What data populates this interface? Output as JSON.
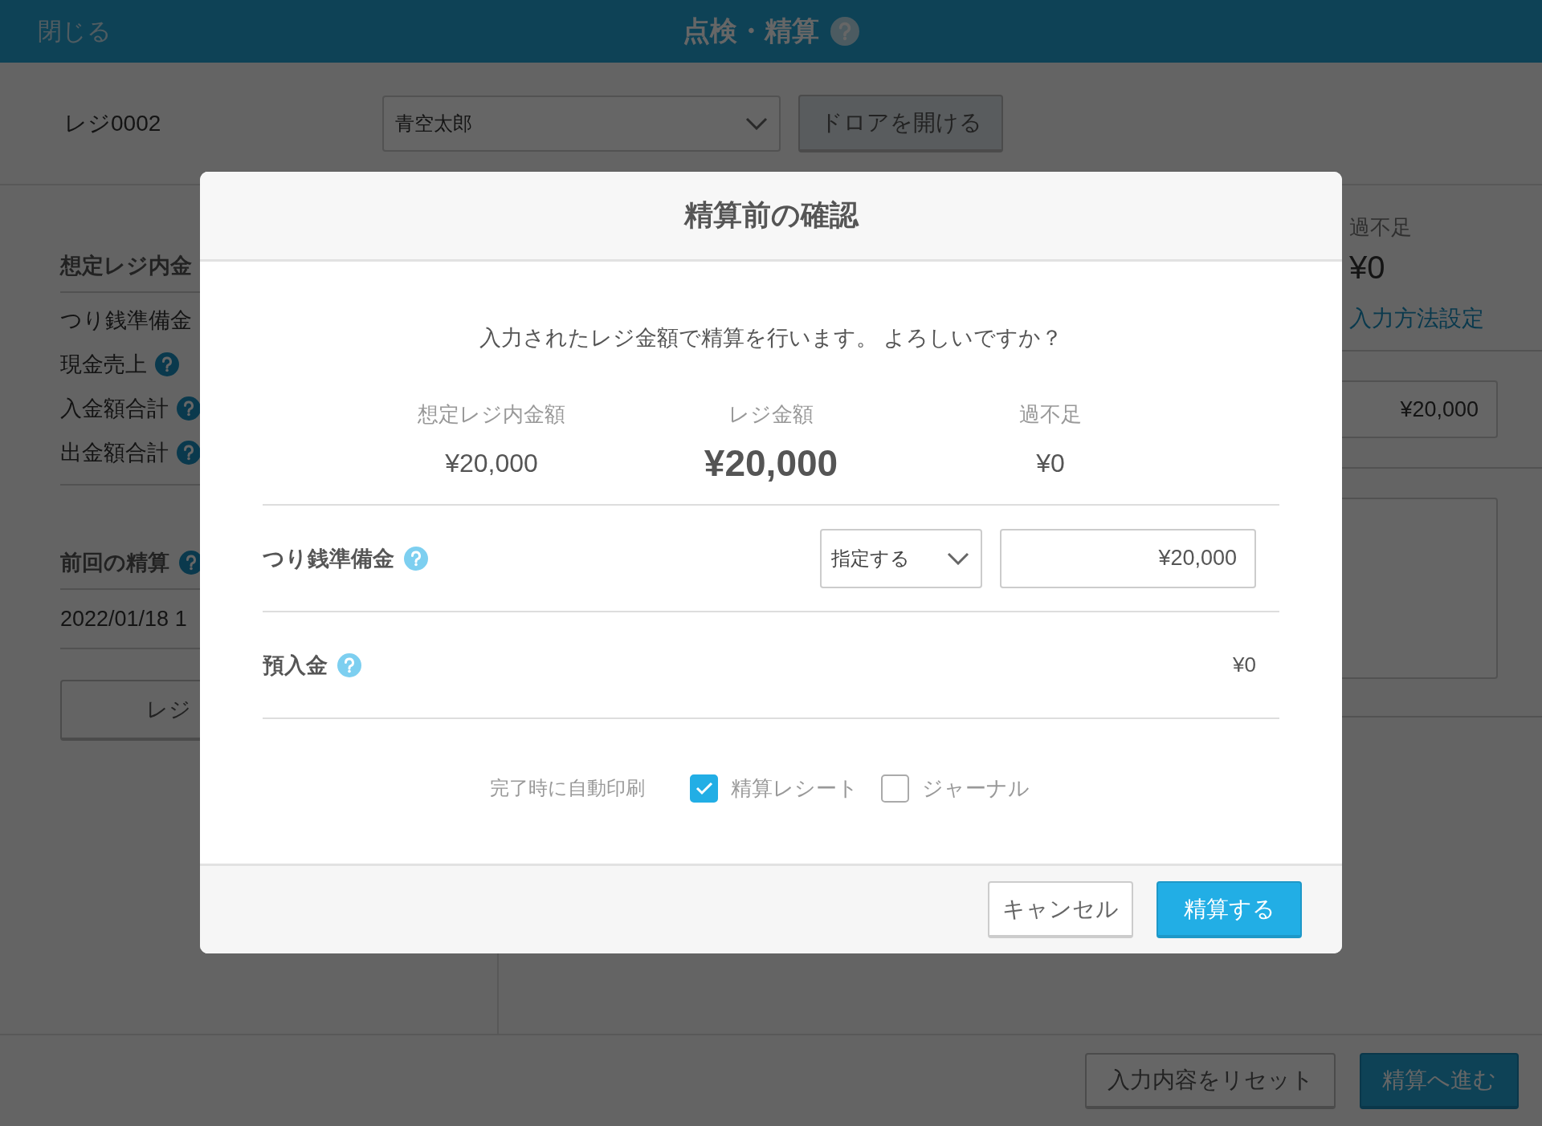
{
  "header": {
    "close": "閉じる",
    "title": "点検・精算"
  },
  "toolbar": {
    "register": "レジ0002",
    "staff_select": {
      "value": "青空太郎"
    },
    "drawer_button": "ドロアを開ける"
  },
  "left": {
    "expected_heading": "想定レジ内金",
    "items": [
      {
        "label": "つり銭準備金"
      },
      {
        "label": "現金売上",
        "help": true
      },
      {
        "label": "入金額合計",
        "help": true
      },
      {
        "label": "出金額合計",
        "help": true
      }
    ],
    "previous_heading": "前回の精算",
    "previous_date": "2022/01/18 1",
    "register_button": "レジ"
  },
  "right": {
    "over_short_label": "過不足",
    "over_short_value": "¥0",
    "input_method_link": "入力方法設定",
    "amount_field": {
      "value": "¥20,000"
    }
  },
  "footer": {
    "buttons": [
      {
        "label": "入力内容をリセット",
        "kind": "secondary"
      },
      {
        "label": "精算へ進む",
        "kind": "primary"
      }
    ]
  },
  "modal": {
    "title": "精算前の確認",
    "message": "入力されたレジ金額で精算を行います。 よろしいですか？",
    "summary": [
      {
        "label": "想定レジ内金額",
        "value": "¥20,000",
        "kind": "normal"
      },
      {
        "label": "レジ金額",
        "value": "¥20,000",
        "kind": "emphasis"
      },
      {
        "label": "過不足",
        "value": "¥0",
        "kind": "normal"
      }
    ],
    "rows": [
      {
        "label": "つり銭準備金",
        "kind": "select_input",
        "select": "指定する",
        "value": "¥20,000"
      },
      {
        "label": "預入金",
        "kind": "text",
        "value": "¥0"
      }
    ],
    "print": {
      "label": "完了時に自動印刷",
      "options": [
        {
          "label": "精算レシート",
          "checked": true
        },
        {
          "label": "ジャーナル",
          "checked": false
        }
      ]
    },
    "buttons": [
      {
        "label": "キャンセル",
        "kind": "secondary"
      },
      {
        "label": "精算する",
        "kind": "primary"
      }
    ]
  }
}
